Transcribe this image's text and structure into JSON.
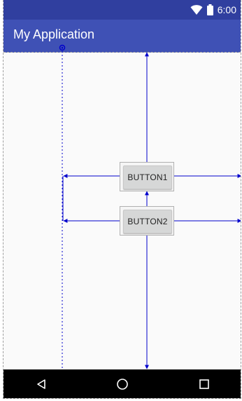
{
  "status_bar": {
    "time": "6:00",
    "icons": [
      "wifi-icon",
      "battery-icon"
    ]
  },
  "app_bar": {
    "title": "My Application"
  },
  "buttons": {
    "button1_label": "BUTTON1",
    "button2_label": "BUTTON2"
  },
  "nav_bar": {
    "icons": [
      "back-icon",
      "home-icon",
      "recents-icon"
    ]
  },
  "colors": {
    "status_bar": "#303f9f",
    "app_bar": "#3f51b5",
    "constraint": "#0000cc",
    "content_bg": "#fafafa"
  }
}
